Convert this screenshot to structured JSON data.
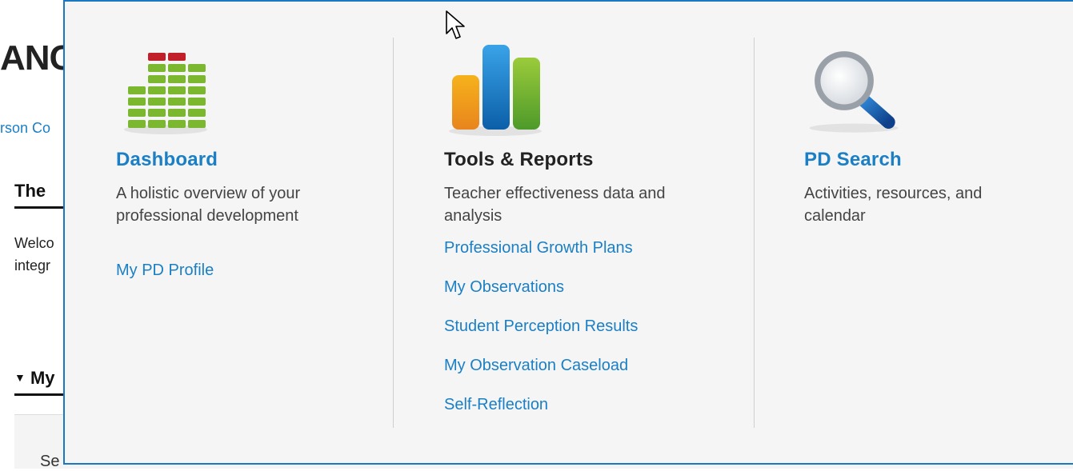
{
  "background": {
    "title_fragment": "ANC",
    "link_fragment": "rson Co",
    "heading_fragment": "The",
    "text_line1": "Welco",
    "text_line2": "integr",
    "section_fragment": "My",
    "bottom_fragment": "Se"
  },
  "menu": {
    "columns": [
      {
        "title": "Dashboard",
        "icon": "equalizer-bars-icon",
        "description": "A holistic overview of your professional development",
        "links": [
          "My PD Profile"
        ]
      },
      {
        "title": "Tools & Reports",
        "icon": "bar-chart-icon",
        "description": "Teacher effectiveness data and analysis",
        "links": [
          "Professional Growth Plans",
          "My Observations",
          "Student Perception Results",
          "My Observation Caseload",
          "Self-Reflection"
        ]
      },
      {
        "title": "PD Search",
        "icon": "magnifying-glass-icon",
        "description": "Activities, resources, and calendar",
        "links": []
      }
    ]
  },
  "colors": {
    "link": "#1a7fc4",
    "menu_border": "#1a78c2",
    "menu_bg": "#f5f5f5"
  }
}
